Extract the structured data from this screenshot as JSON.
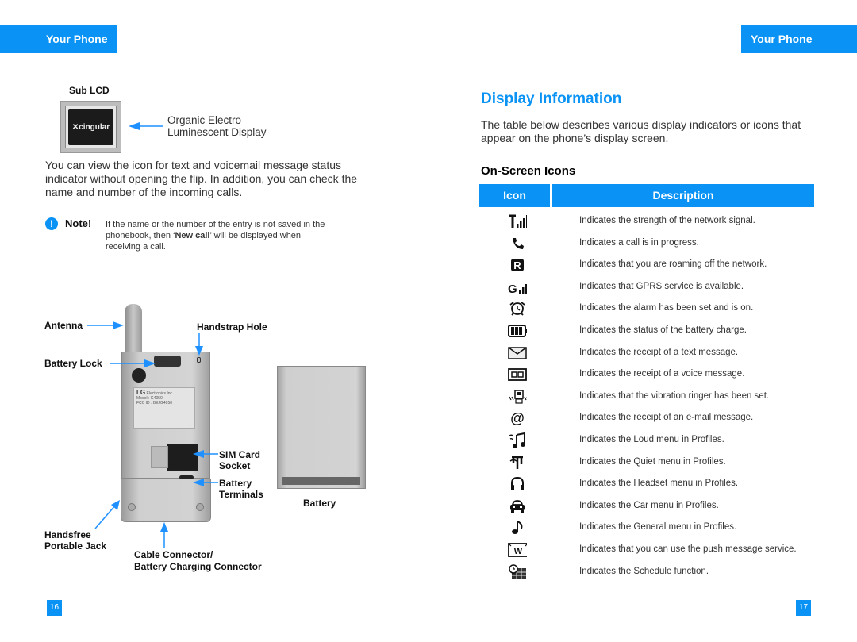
{
  "header": {
    "left_tab": "Your Phone",
    "right_tab": "Your Phone"
  },
  "left_page": {
    "sub_lcd_label": "Sub LCD",
    "sub_lcd_brand": "cingular",
    "oled_caption_line1": "Organic Electro",
    "oled_caption_line2": "Luminescent Display",
    "intro_line1": "You can view the icon for text and voicemail message status",
    "intro_line2": "indicator without opening the flip. In addition, you can check the",
    "intro_line3": "name and number of the incoming calls.",
    "note": {
      "label": "Note!",
      "line1": "If the name or the number of the entry is not saved in the",
      "line2_pre": "phonebook, then ‘",
      "line2_bold": "New call",
      "line2_post": "’ will be displayed when",
      "line3": "receiving a call."
    },
    "diagram": {
      "antenna": "Antenna",
      "handstrap_hole": "Handstrap Hole",
      "battery_lock": "Battery Lock",
      "sim_card_socket_1": "SIM Card",
      "sim_card_socket_2": "Socket",
      "battery_terminals_1": "Battery",
      "battery_terminals_2": "Terminals",
      "battery": "Battery",
      "handsfree_1": "Handsfree",
      "handsfree_2": "Portable Jack",
      "cable_connector_1": "Cable Connector/",
      "cable_connector_2": "Battery Charging Connector",
      "phone_label_brand": "LG",
      "phone_label_company": "Electronics Inc.",
      "phone_label_model": "Model : G4050",
      "phone_label_fcc": "FCC ID : BEJG4050"
    },
    "page_number": "16"
  },
  "right_page": {
    "title": "Display Information",
    "intro_line1": "The table below describes various display indicators or icons that",
    "intro_line2": "appear on the phone’s display screen.",
    "section_title": "On-Screen Icons",
    "table": {
      "headers": [
        "Icon",
        "Description"
      ],
      "rows": [
        {
          "icon": "signal-strength-icon",
          "description": "Indicates the strength of the network signal."
        },
        {
          "icon": "call-in-progress-icon",
          "description": "Indicates a call is in progress."
        },
        {
          "icon": "roaming-icon",
          "description": "Indicates that you are roaming off the network."
        },
        {
          "icon": "gprs-icon",
          "description": "Indicates that GPRS service is available."
        },
        {
          "icon": "alarm-icon",
          "description": "Indicates the alarm has been set and is on."
        },
        {
          "icon": "battery-icon",
          "description": "Indicates the status of the battery charge."
        },
        {
          "icon": "text-message-icon",
          "description": "Indicates the receipt of a text message."
        },
        {
          "icon": "voice-message-icon",
          "description": "Indicates the receipt of a voice message."
        },
        {
          "icon": "vibration-icon",
          "description": "Indicates that the vibration ringer has been set."
        },
        {
          "icon": "email-icon",
          "description": "Indicates the receipt of an e-mail message."
        },
        {
          "icon": "loud-profile-icon",
          "description": "Indicates the Loud menu in Profiles."
        },
        {
          "icon": "quiet-profile-icon",
          "description": "Indicates the Quiet menu in Profiles."
        },
        {
          "icon": "headset-profile-icon",
          "description": "Indicates the Headset menu in Profiles."
        },
        {
          "icon": "car-profile-icon",
          "description": "Indicates the Car menu in Profiles."
        },
        {
          "icon": "general-profile-icon",
          "description": "Indicates the General menu in Profiles."
        },
        {
          "icon": "push-message-icon",
          "description": "Indicates that you can use the push message service."
        },
        {
          "icon": "schedule-icon",
          "description": "Indicates the Schedule function."
        }
      ]
    },
    "page_number": "17"
  },
  "colors": {
    "accent": "#0a93f5",
    "arrow": "#1e90ff"
  }
}
